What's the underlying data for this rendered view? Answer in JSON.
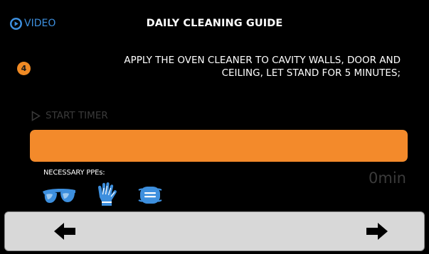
{
  "header": {
    "video_label": "VIDEO",
    "title": "DAILY CLEANING GUIDE"
  },
  "step": {
    "number": "4",
    "instruction_line1": "APPLY THE OVEN CLEANER TO CAVITY WALLS, DOOR AND",
    "instruction_line2": "CEILING, LET STAND FOR 5 MINUTES;"
  },
  "timer": {
    "start_label": "START TIMER",
    "value": "0min",
    "progress_percent": 100
  },
  "ppe": {
    "label": "NECESSARY PPEs:",
    "items": [
      "safety-goggles-icon",
      "gloves-icon",
      "mask-icon"
    ]
  },
  "navigation": {
    "prev_icon": "arrow-left-icon",
    "next_icon": "arrow-right-icon"
  },
  "colors": {
    "accent_orange": "#f38a2b",
    "ppe_blue": "#3d8fde",
    "background": "#000000",
    "nav_bar": "#d8d8d8"
  }
}
